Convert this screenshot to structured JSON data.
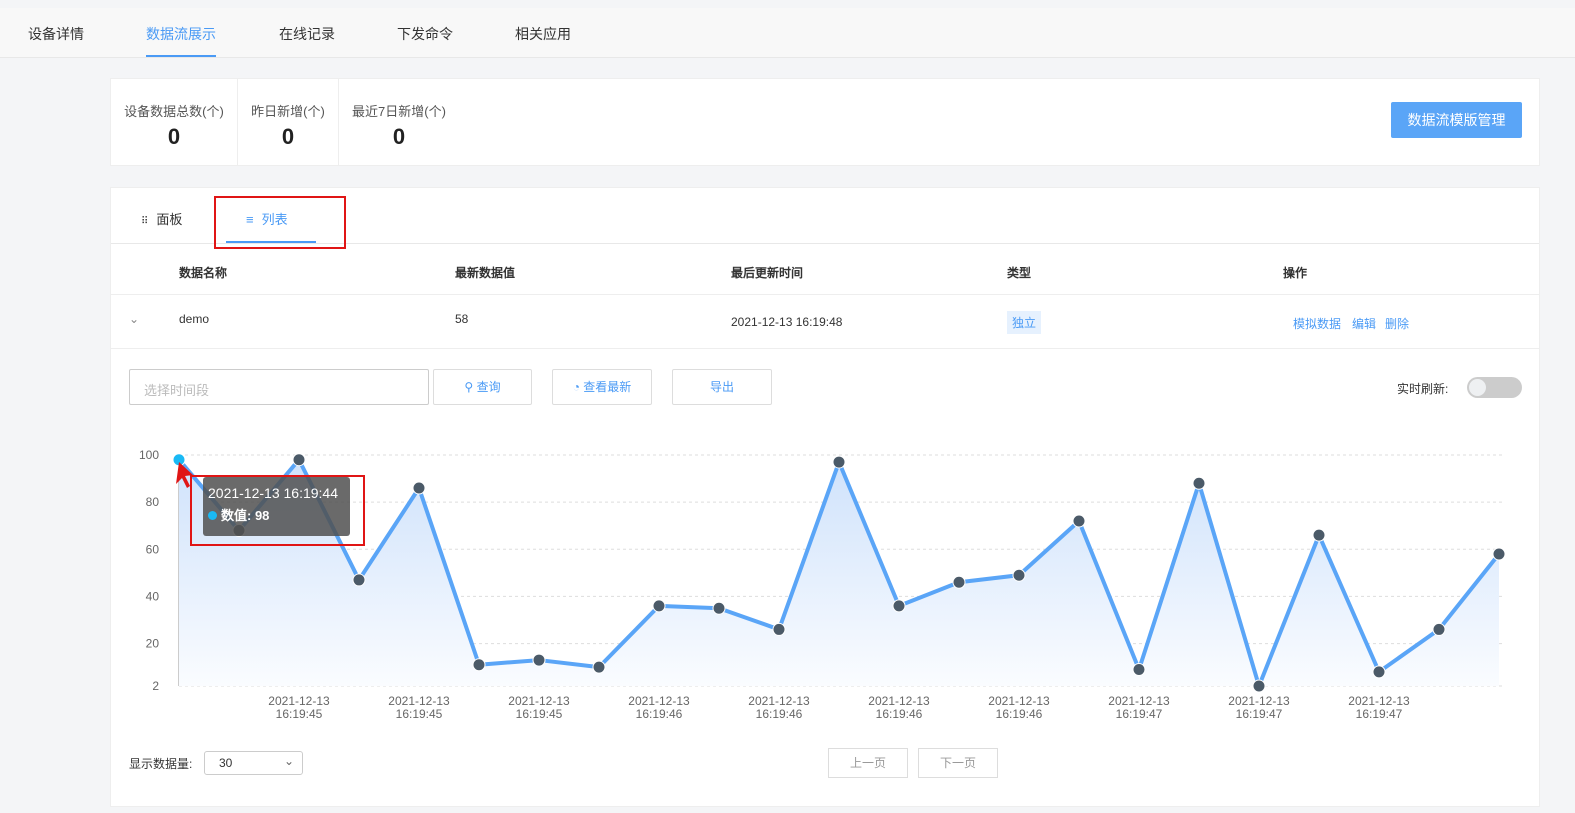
{
  "nav": {
    "tabs": [
      "设备详情",
      "数据流展示",
      "在线记录",
      "下发命令",
      "相关应用"
    ],
    "active": 1
  },
  "stats": [
    {
      "label": "设备数据总数(个)",
      "value": "0"
    },
    {
      "label": "昨日新增(个)",
      "value": "0"
    },
    {
      "label": "最近7日新增(个)",
      "value": "0"
    }
  ],
  "template_button": "数据流模版管理",
  "view_tabs": {
    "panel": "面板",
    "list": "列表"
  },
  "table": {
    "headers": [
      "数据名称",
      "最新数据值",
      "最后更新时间",
      "类型",
      "操作"
    ],
    "rows": [
      {
        "name": "demo",
        "latest": "58",
        "updated": "2021-12-13 16:19:48",
        "type": "独立",
        "actions": [
          "模拟数据",
          "编辑",
          "删除"
        ]
      }
    ]
  },
  "filters": {
    "time_placeholder": "选择时间段",
    "query": "查询",
    "latest": "查看最新",
    "export": "导出",
    "realtime_label": "实时刷新:",
    "realtime_on": false
  },
  "tooltip": {
    "time": "2021-12-13 16:19:44",
    "label": "数值: 98"
  },
  "footer": {
    "count_label": "显示数据量:",
    "count_value": "30",
    "prev": "上一页",
    "next": "下一页"
  },
  "colors": {
    "accent": "#4a9af5",
    "line": "#5aa5f7",
    "point": "#4b5a68",
    "highlight": "#19b9f5"
  },
  "chart_data": {
    "type": "area",
    "y_ticks": [
      2,
      20,
      40,
      60,
      80,
      100
    ],
    "ylim": [
      2,
      100
    ],
    "values": [
      98,
      68,
      98,
      47,
      86,
      11,
      13,
      10,
      36,
      35,
      26,
      97,
      36,
      46,
      49,
      72,
      9,
      88,
      2,
      66,
      8,
      26,
      58
    ],
    "x_labels": [
      {
        "index": 2,
        "date": "2021-12-13",
        "time": "16:19:45"
      },
      {
        "index": 4,
        "date": "2021-12-13",
        "time": "16:19:45"
      },
      {
        "index": 6,
        "date": "2021-12-13",
        "time": "16:19:45"
      },
      {
        "index": 8,
        "date": "2021-12-13",
        "time": "16:19:46"
      },
      {
        "index": 10,
        "date": "2021-12-13",
        "time": "16:19:46"
      },
      {
        "index": 12,
        "date": "2021-12-13",
        "time": "16:19:46"
      },
      {
        "index": 14,
        "date": "2021-12-13",
        "time": "16:19:46"
      },
      {
        "index": 16,
        "date": "2021-12-13",
        "time": "16:19:47"
      },
      {
        "index": 18,
        "date": "2021-12-13",
        "time": "16:19:47"
      },
      {
        "index": 20,
        "date": "2021-12-13",
        "time": "16:19:47"
      }
    ],
    "highlight_index": 0
  }
}
